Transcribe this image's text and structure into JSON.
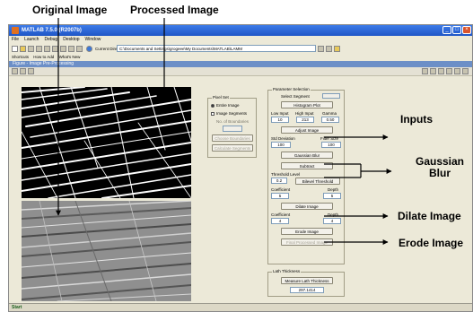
{
  "callouts": {
    "original_image": "Original Image",
    "processed_image": "Processed Image",
    "inputs": "Inputs",
    "gaussian_blur": "Gaussian Blur",
    "dilate_image": "Dilate Image",
    "erode_image": "Erode Image"
  },
  "app": {
    "title": "MATLAB 7.5.0 (R2007b)",
    "menu": [
      "File",
      "Launch",
      "Debug",
      "Desktop",
      "Window"
    ],
    "current_directory_label": "Current Directory:",
    "current_directory_value": "C:\\Documents and Settings\\grogeee\\My Documents\\MATLAB\\LAMM",
    "shortcuts": [
      "Shortcuts",
      "How to Add",
      "What's New"
    ],
    "figure_title": "Figure - Image Pre-Processing",
    "start_label": "Start"
  },
  "pixel_panel": {
    "title": "Pixel Set",
    "option_entire": "Entire Image",
    "option_segments": "Image Segments",
    "segments_label": "No. of Boundaries",
    "choose_boundaries": "Choose Boundaries",
    "calculate_segments": "Calculate Segments"
  },
  "params": {
    "title": "Parameter Selection",
    "select_segment": "Select Segment",
    "histogram_plot": "Histogram Plot",
    "low_input_label": "Low Input",
    "high_input_label": "High Input",
    "gamma_label": "Gamma",
    "low_input": "10",
    "high_input": "213",
    "gamma": "0.50",
    "adjust_image": "Adjust Image",
    "std_dev_label": "Std Deviation",
    "filter_size_label": "Filter Size",
    "std_dev": "100",
    "filter_size": "100",
    "gaussian_blur": "Gaussian Blur",
    "subtract": "Subtract",
    "threshold_label": "Threshold Level",
    "threshold": "0.2",
    "bilevel_threshold": "Bilevel Threshold",
    "coefficient_label": "Coefficient",
    "depth_label": "Depth",
    "coefficient": "5",
    "depth": "5",
    "dilate_image": "Dilate Image",
    "coefficient2_label": "Coefficient",
    "depth2_label": "Depth",
    "coefficient2": "4",
    "depth2": "4",
    "erode_image": "Erode Image",
    "final_processed": "Final Processed Image"
  },
  "lath": {
    "title": "Lath Thickness",
    "measure": "Measure Lath Thickness",
    "value": "297.1414"
  },
  "colors": {
    "titlebar": "#2456c6",
    "window_bg": "#ece9d8",
    "figure_bar": "#6c8fc7"
  }
}
